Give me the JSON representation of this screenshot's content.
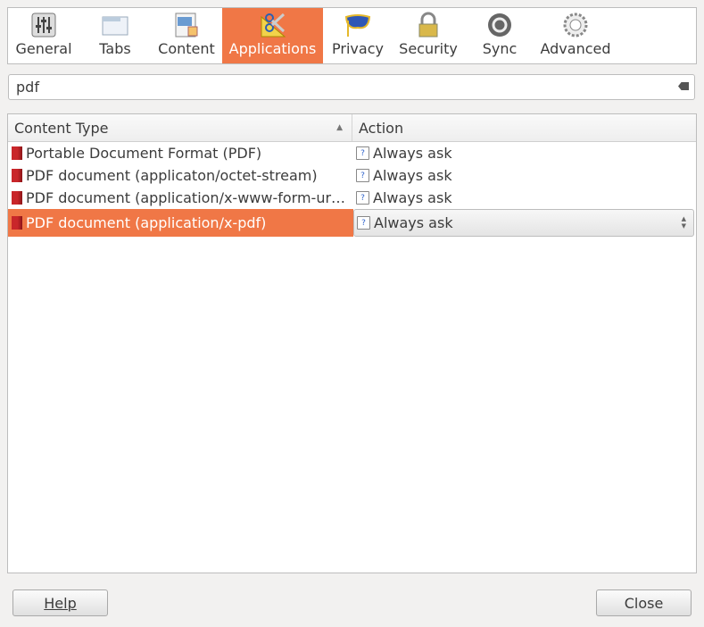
{
  "tabs": [
    {
      "label": "General",
      "icon": "sliders-icon"
    },
    {
      "label": "Tabs",
      "icon": "tabs-window-icon"
    },
    {
      "label": "Content",
      "icon": "content-page-icon"
    },
    {
      "label": "Applications",
      "icon": "scissors-ruler-icon",
      "selected": true
    },
    {
      "label": "Privacy",
      "icon": "mask-icon"
    },
    {
      "label": "Security",
      "icon": "padlock-icon"
    },
    {
      "label": "Sync",
      "icon": "sync-icon"
    },
    {
      "label": "Advanced",
      "icon": "gear-icon"
    }
  ],
  "search": {
    "value": "pdf"
  },
  "table": {
    "headers": [
      "Content Type",
      "Action"
    ],
    "rows": [
      {
        "type": "Portable Document Format (PDF)",
        "action": "Always ask"
      },
      {
        "type": "PDF document (applicaton/octet-stream)",
        "action": "Always ask"
      },
      {
        "type": "PDF document (application/x-www-form-ur…",
        "action": "Always ask"
      },
      {
        "type": "PDF document (application/x-pdf)",
        "action": "Always ask",
        "selected": true
      }
    ]
  },
  "buttons": {
    "help": "Help",
    "close": "Close"
  },
  "colors": {
    "accent": "#f07746"
  }
}
